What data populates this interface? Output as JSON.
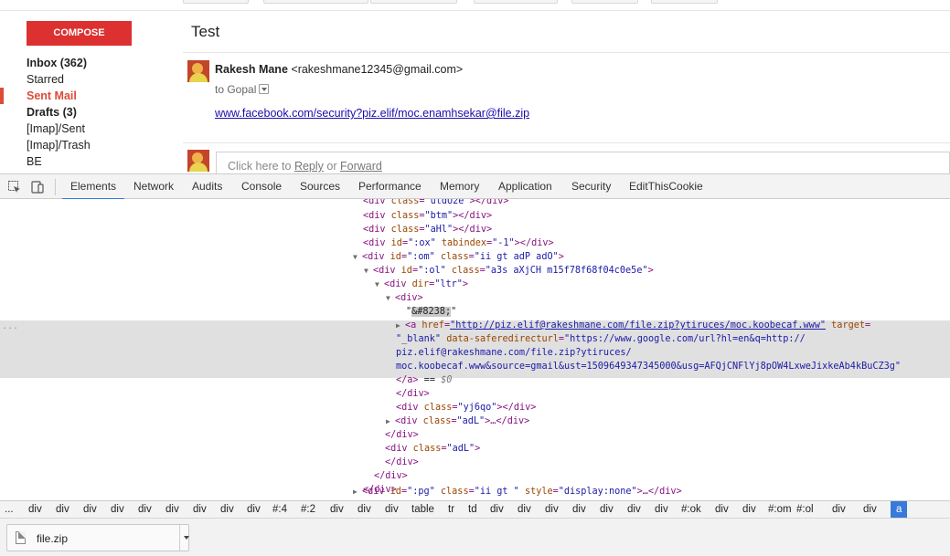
{
  "gmail": {
    "compose_label": "COMPOSE",
    "nav_items": [
      {
        "label": "Inbox (362)"
      },
      {
        "label": "Starred"
      },
      {
        "label": "Sent Mail"
      },
      {
        "label": "Drafts (3)"
      },
      {
        "label": "[Imap]/Sent"
      },
      {
        "label": "[Imap]/Trash"
      },
      {
        "label": "BE"
      }
    ],
    "subject": "Test",
    "sender_name": "Rakesh Mane",
    "sender_email": "<rakeshmane12345@gmail.com>",
    "to_label": "to Gopal",
    "message_link": "www.facebook.com/security?piz.elif/moc.enamhsekar@file.zip",
    "reply_prefix": "Click here to ",
    "reply_link": "Reply",
    "reply_or": " or ",
    "forward_link": "Forward"
  },
  "devtools": {
    "tabs": [
      "Elements",
      "Network",
      "Audits",
      "Console",
      "Sources",
      "Performance",
      "Memory",
      "Application",
      "Security",
      "EditThisCookie"
    ],
    "active_tab": "Elements",
    "elements": {
      "l0_tag": "<div ",
      "l0_attr": "class",
      "l0_val": "\"utdU2e\"",
      "l0_end": "></div>",
      "l1_tag": "<div ",
      "l1_attr": "class",
      "l1_val": "\"btm\"",
      "l1_end": "></div>",
      "l2_tag": "<div ",
      "l2_attr": "class",
      "l2_val": "\"aHl\"",
      "l2_end": "></div>",
      "l3_tag": "<div ",
      "l3_attr": "id",
      "l3_val": "\":ox\"",
      "l3_attr2": "tabindex",
      "l3_val2": "\"-1\"",
      "l3_end": "></div>",
      "l4_tag": "<div ",
      "l4_attr": "id",
      "l4_val": "\":om\"",
      "l4_attr2": "class",
      "l4_val2": "\"ii gt adP adO\"",
      "l4_end": ">",
      "l5_tag": "<div ",
      "l5_attr": "id",
      "l5_val": "\":ol\"",
      "l5_attr2": "class",
      "l5_val2": "\"a3s aXjCH m15f78f68f04c0e5e\"",
      "l5_end": ">",
      "l6_tag": "<div ",
      "l6_attr": "dir",
      "l6_val": "\"ltr\"",
      "l6_end": ">",
      "l7_tag": "<div>",
      "l8_q1": "\"",
      "l8_ent": "&#8238;",
      "l8_q2": "\"",
      "l9_tag": "<a ",
      "l9_attr": "href",
      "l9_val": "\"http://piz.elif@rakeshmane.com/file.zip?ytiruces/moc.koobecaf.www\"",
      "l9_attr2": "target",
      "l10_val": "\"_blank\"",
      "l10_attr": "data-saferedirecturl",
      "l10_val2": "\"https://www.google.com/url?hl=en&q=http://",
      "l11_val": "piz.elif@rakeshmane.com/file.zip?ytiruces/",
      "l12_val": "moc.koobecaf.www&source=gmail&ust=1509649347345000&usg=AFQjCNFlYj8pOW4LxweJixkeAb4kBuCZ3g\"",
      "l13_tag": "</a>",
      "l13_eq": " == ",
      "l13_dollar": "$0",
      "l14_tag": "</div>",
      "l15_tag": "<div ",
      "l15_attr": "class",
      "l15_val": "\"yj6qo\"",
      "l15_end": "></div>",
      "l16_tag": "<div ",
      "l16_attr": "class",
      "l16_val": "\"adL\"",
      "l16_end": ">…</div>",
      "l17_tag": "</div>",
      "l18_tag": "<div ",
      "l18_attr": "class",
      "l18_val": "\"adL\"",
      "l18_end": ">",
      "l19_tag": "</div>",
      "l20_tag": "</div>",
      "l21_tag": "</div>",
      "l22_tag": "<div ",
      "l22_attr": "id",
      "l22_val": "\":pg\"",
      "l22_attr2": "class",
      "l22_val2": "\"ii gt \"",
      "l22_attr3": "style",
      "l22_val3": "\"display:none\"",
      "l22_end": ">…</div>"
    },
    "ellipsis": "...",
    "breadcrumbs": [
      "...",
      "div",
      "div",
      "div",
      "div",
      "div",
      "div",
      "div",
      "div",
      "div",
      "#:4",
      "#:2",
      "div",
      "div",
      "div",
      "table",
      "tr",
      "td",
      "div",
      "div",
      "div",
      "div",
      "div",
      "div",
      "div",
      "#:ok",
      "div",
      "div",
      "#:om",
      "#:ol",
      "div",
      "div",
      "a"
    ]
  },
  "downloads": {
    "file_name": "file.zip"
  }
}
